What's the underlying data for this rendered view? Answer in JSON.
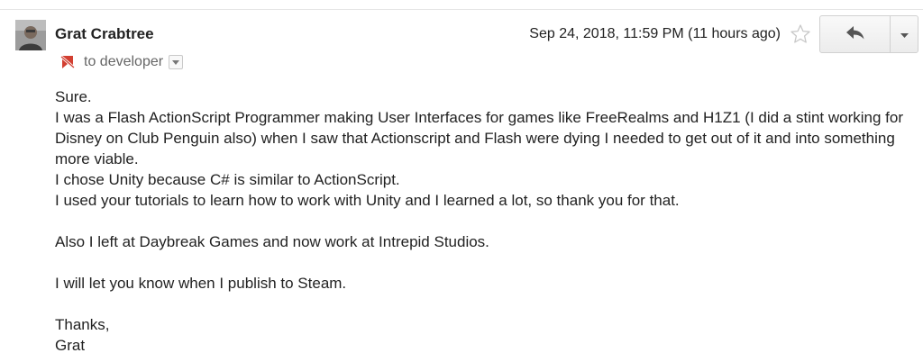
{
  "email": {
    "sender": "Grat Crabtree",
    "recipient": "to developer",
    "date": "Sep 24, 2018, 11:59 PM (11 hours ago)",
    "body": [
      "Sure.",
      "I was a Flash ActionScript Programmer making User Interfaces for games like FreeRealms and H1Z1 (I did a stint working for Disney on Club Penguin also) when I saw that Actionscript and Flash were dying I needed to get out of it and into something more viable.",
      "I chose Unity because C# is similar to ActionScript.",
      "I used your tutorials to learn how to work with Unity and I learned a lot, so thank you for that.",
      "",
      "Also I left at Daybreak Games and now work at Intrepid Studios.",
      "",
      "I will let you know when I publish to Steam.",
      "",
      "Thanks,",
      "Grat"
    ]
  },
  "icons": {
    "label": "label-important-off-icon",
    "star": "star-outline-icon",
    "reply": "reply-arrow-icon",
    "more": "chevron-down-icon"
  },
  "colors": {
    "label_red": "#d23f31",
    "muted": "#666666",
    "text": "#222222"
  }
}
